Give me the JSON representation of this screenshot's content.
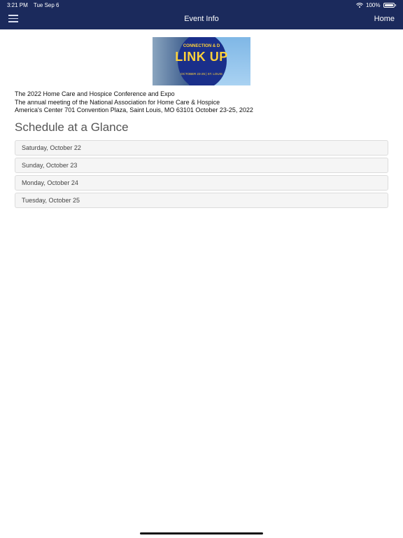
{
  "status_bar": {
    "time": "3:21 PM",
    "date": "Tue Sep 6",
    "battery": "100%"
  },
  "nav": {
    "title": "Event Info",
    "home_label": "Home"
  },
  "banner": {
    "line1": "CONNECTION & D",
    "line2": "LINK UP",
    "line3": "OCTOBER 23-25 | ST. LOUIS"
  },
  "event": {
    "name": "The 2022 Home Care and Hospice Conference and Expo",
    "description": "The annual meeting of the National Association for Home Care & Hospice",
    "location": "America's Center 701 Convention Plaza, Saint Louis, MO 63101 October 23-25, 2022"
  },
  "schedule": {
    "title": "Schedule at a Glance",
    "days": [
      "Saturday, October 22",
      "Sunday, October 23",
      "Monday, October 24",
      "Tuesday, October 25"
    ]
  },
  "colors": {
    "nav_background": "#1b2a5c",
    "accent": "#ffd23a"
  },
  "icons": {
    "menu": "hamburger-menu-icon",
    "wifi": "wifi-icon",
    "battery": "battery-icon"
  }
}
